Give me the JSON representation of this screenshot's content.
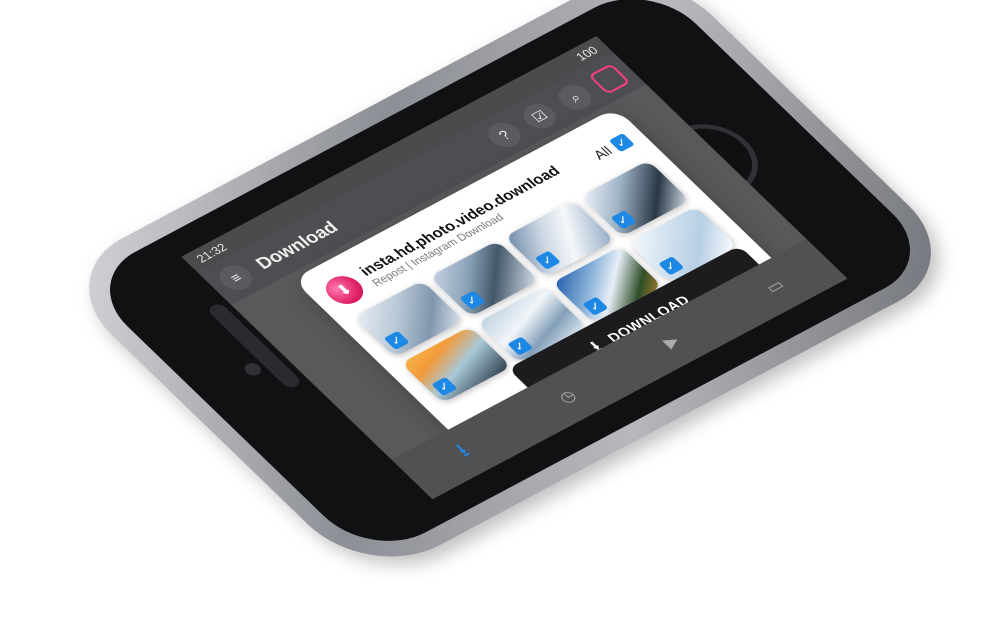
{
  "status": {
    "time": "21:32",
    "battery": "100"
  },
  "appbar": {
    "title": "Download"
  },
  "dialog": {
    "app_name": "insta.hd.photo.video.download",
    "app_subtitle": "Repost | Instagram Download",
    "all_label": "All",
    "download_label": "DOWNLOAD"
  },
  "icons": {
    "menu": "menu-icon",
    "help": "help-icon",
    "select": "select-icon",
    "search": "search-icon",
    "instagram": "instagram-icon",
    "check": "check-icon",
    "download": "download-icon",
    "history": "history-icon",
    "video": "video-icon",
    "image": "image-icon"
  },
  "colors": {
    "accent": "#1e88e5",
    "dialog_button": "#1c1c1e",
    "instagram": "#e02266"
  }
}
